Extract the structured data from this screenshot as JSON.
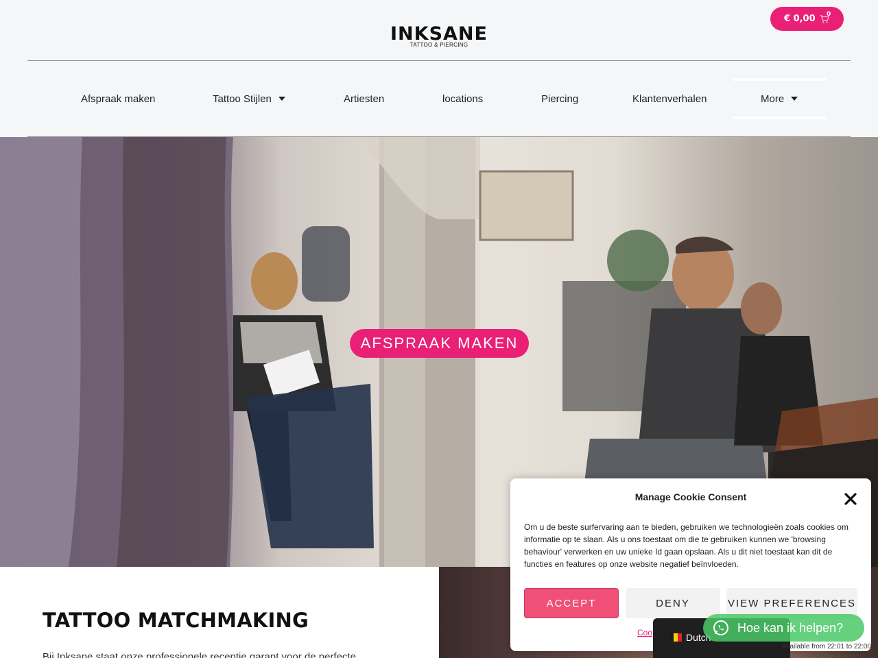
{
  "header": {
    "logo_main": "INKSANE",
    "logo_sub": "TATTOO & PIERCING",
    "cart": {
      "amount": "€ 0,00",
      "count": "0"
    }
  },
  "nav": {
    "items": [
      {
        "label": "Afspraak maken"
      },
      {
        "label": "Tattoo Stijlen"
      },
      {
        "label": "Artiesten"
      },
      {
        "label": "locations"
      },
      {
        "label": "Piercing"
      },
      {
        "label": "Klantenverhalen"
      },
      {
        "label": "More"
      }
    ]
  },
  "hero": {
    "cta_label": "AFSPRAAK MAKEN"
  },
  "section": {
    "title": "TATTOO MATCHMAKING",
    "body": "Bij Inksane staat onze professionele receptie garant voor de perfecte"
  },
  "cookie": {
    "title": "Manage Cookie Consent",
    "text": "Om u de beste surfervaring aan te bieden, gebruiken we technologieën zoals cookies om informatie op te slaan. Als u ons toestaat om die te gebruiken kunnen we 'browsing behaviour' verwerken en uw unieke Id gaan opslaan. Als u dit niet toestaat kan dit de functies en features op onze website negatief beïnvloeden.",
    "accept_label": "ACCEPT",
    "deny_label": "DENY",
    "prefs_label": "VIEW PREFERENCES",
    "policy_link": "Coo"
  },
  "language": {
    "label": "Dutch"
  },
  "whatsapp": {
    "label": "Hoe kan ik helpen?",
    "availability": "Available from 22:01 to 22:00"
  },
  "colors": {
    "brand_pink": "#ea1f76",
    "accept_pink": "#f04f78",
    "whatsapp_green": "#4ac967",
    "header_bg": "#f5f6f8"
  },
  "icons": {
    "cart": "cart-icon",
    "caret": "chevron-down-icon",
    "close": "close-icon",
    "whatsapp": "whatsapp-icon",
    "flag": "flag-icon"
  }
}
